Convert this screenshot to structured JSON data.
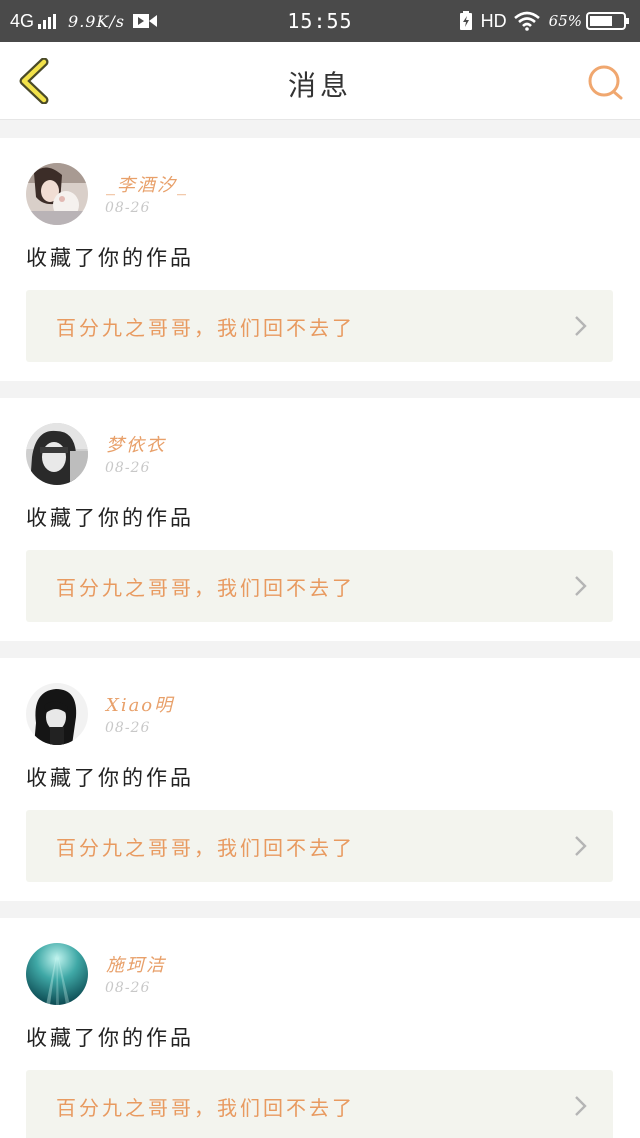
{
  "status_bar": {
    "network": "4G",
    "speed": "9.9K/s",
    "time": "15:55",
    "hd": "HD",
    "battery": "65%"
  },
  "header": {
    "title": "消息",
    "back_icon": "chevron-left-icon",
    "search_icon": "search-icon",
    "accent_color": "#e8a06a"
  },
  "messages": [
    {
      "user": "_李酒汐_",
      "date": "08-26",
      "action": "收藏了你的作品",
      "work": "百分九之哥哥，我们回不去了",
      "avatar": "avatar-girl-with-toy"
    },
    {
      "user": "梦依衣",
      "date": "08-26",
      "action": "收藏了你的作品",
      "work": "百分九之哥哥，我们回不去了",
      "avatar": "avatar-grayscale-girl"
    },
    {
      "user": "Xiao明",
      "date": "08-26",
      "action": "收藏了你的作品",
      "work": "百分九之哥哥，我们回不去了",
      "avatar": "avatar-dark-anime"
    },
    {
      "user": "施珂洁",
      "date": "08-26",
      "action": "收藏了你的作品",
      "work": "百分九之哥哥，我们回不去了",
      "avatar": "avatar-underwater"
    }
  ]
}
